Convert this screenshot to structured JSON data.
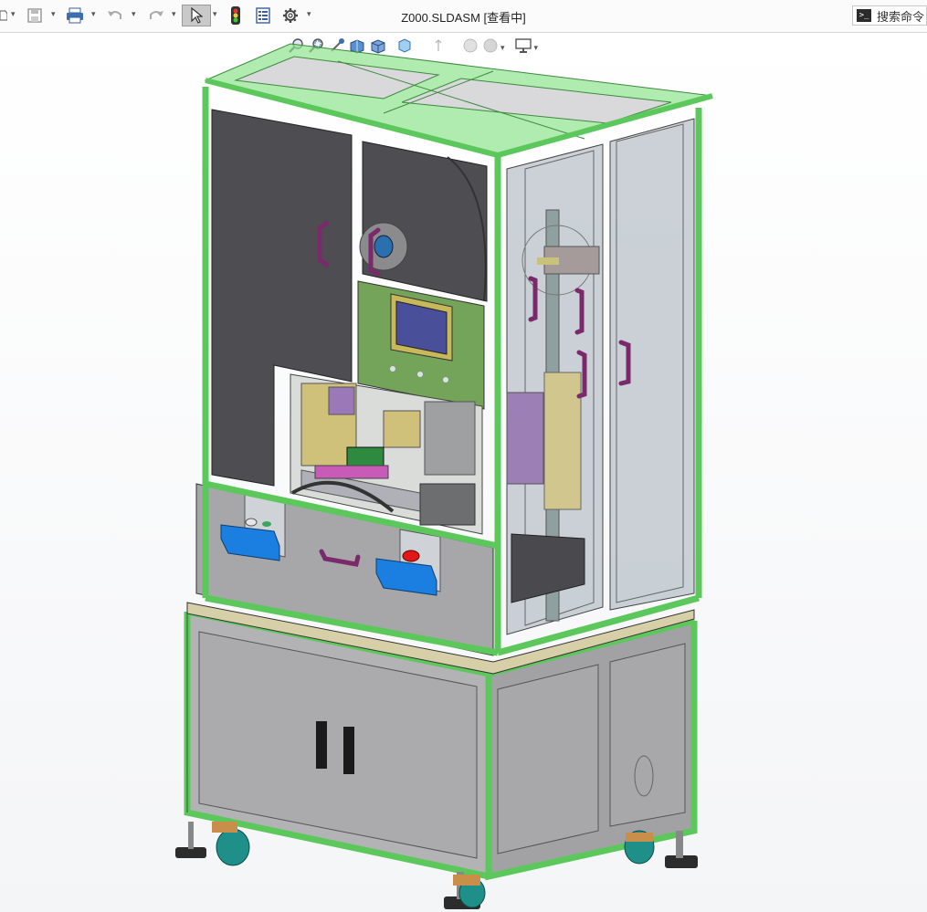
{
  "document": {
    "title": "Z000.SLDASM [查看中]"
  },
  "search": {
    "label": "搜索命令"
  },
  "toolbar": {
    "items": [
      "new-file-icon",
      "save-icon",
      "print-icon",
      "undo-icon",
      "redo-icon",
      "select-pointer-icon",
      "traffic-light-icon",
      "file-properties-icon",
      "options-gear-icon"
    ]
  },
  "heads_up_toolbar": {
    "items": [
      "zoom-to-fit-icon",
      "zoom-to-area-icon",
      "previous-view-icon",
      "section-view-icon",
      "view-orientation-icon",
      "display-style-icon",
      "hide-show-items-icon",
      "edit-appearance-icon",
      "apply-scene-icon",
      "view-settings-icon"
    ]
  },
  "colors": {
    "frame_green": "#5cc85c",
    "panel_gray": "#a9a9ab",
    "dark_panel": "#4d4d52",
    "handle": "#7a2a6a",
    "button_blue": "#1a7fe0",
    "screen": "#4a4f9a",
    "glass": "#b9c2c8"
  }
}
